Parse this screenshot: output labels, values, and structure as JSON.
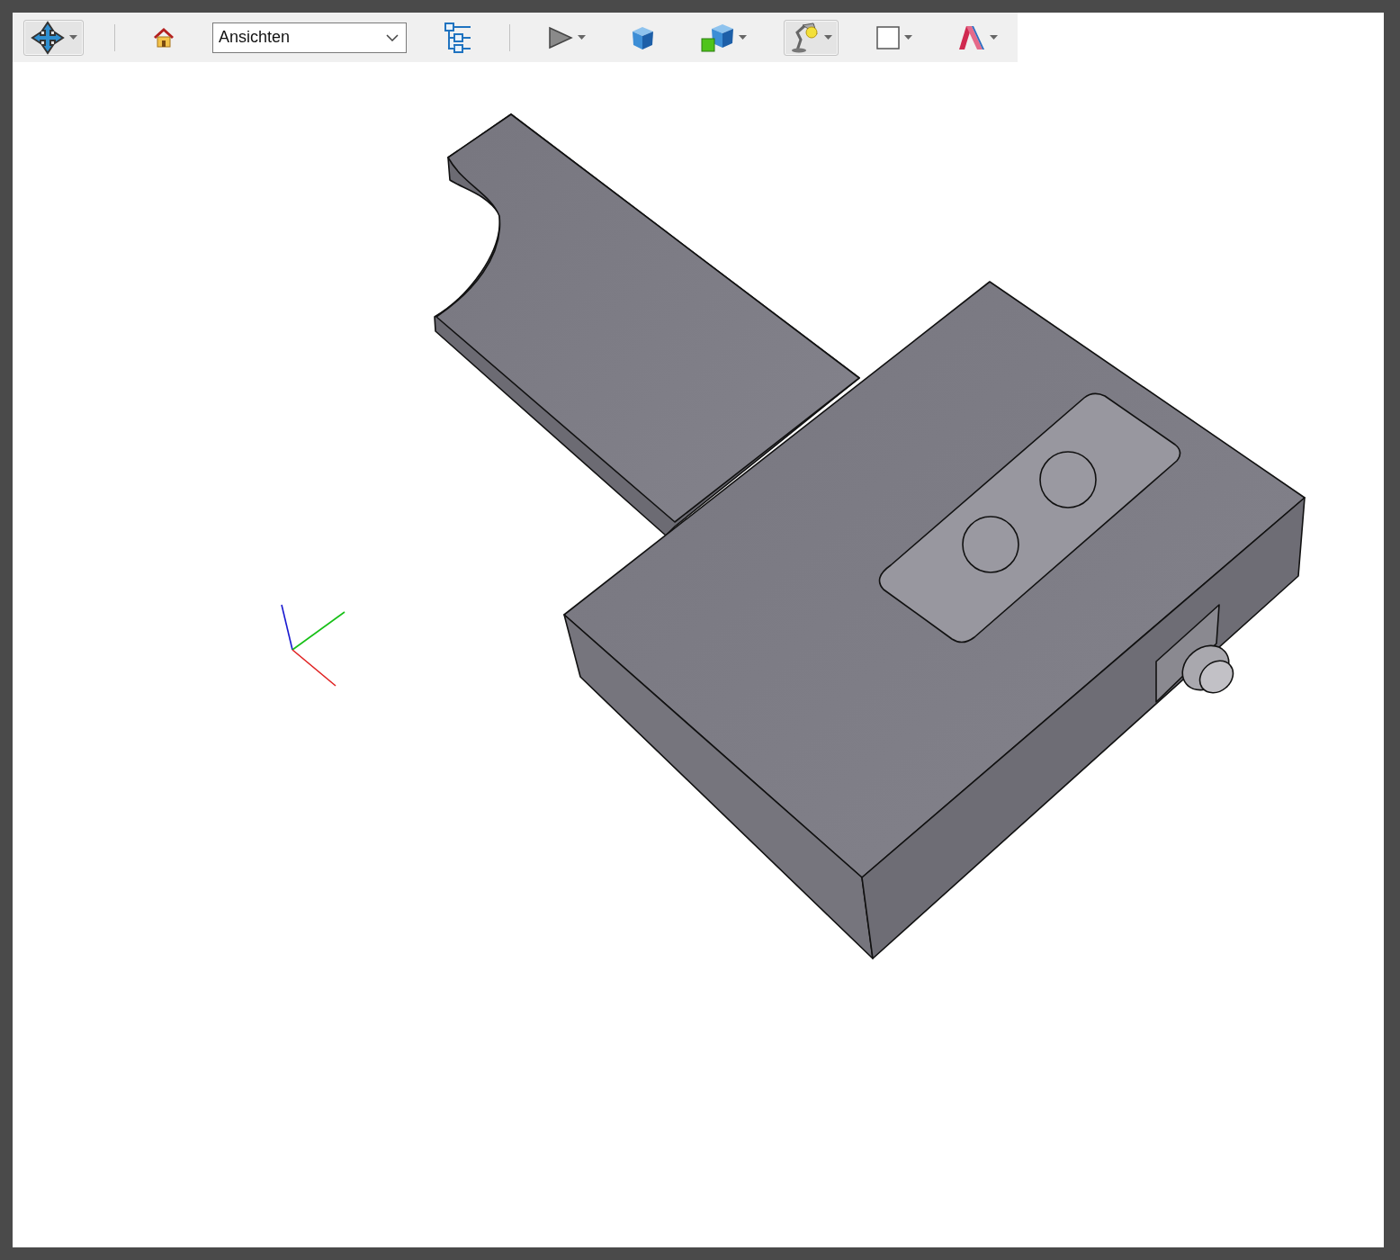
{
  "toolbar": {
    "items": [
      {
        "kind": "pan",
        "pressed": true,
        "menu": true
      },
      {
        "kind": "separator"
      },
      {
        "kind": "home",
        "pressed": false,
        "menu": false
      },
      {
        "kind": "select",
        "value": "Ansichten"
      },
      {
        "kind": "tree",
        "pressed": false,
        "menu": false
      },
      {
        "kind": "separator"
      },
      {
        "kind": "play",
        "pressed": false,
        "menu": true
      },
      {
        "kind": "cube",
        "pressed": false,
        "menu": false
      },
      {
        "kind": "cubes",
        "pressed": false,
        "menu": true
      },
      {
        "kind": "lamp",
        "pressed": true,
        "menu": true
      },
      {
        "kind": "square",
        "pressed": false,
        "menu": true
      },
      {
        "kind": "section",
        "pressed": false,
        "menu": true
      }
    ]
  }
}
